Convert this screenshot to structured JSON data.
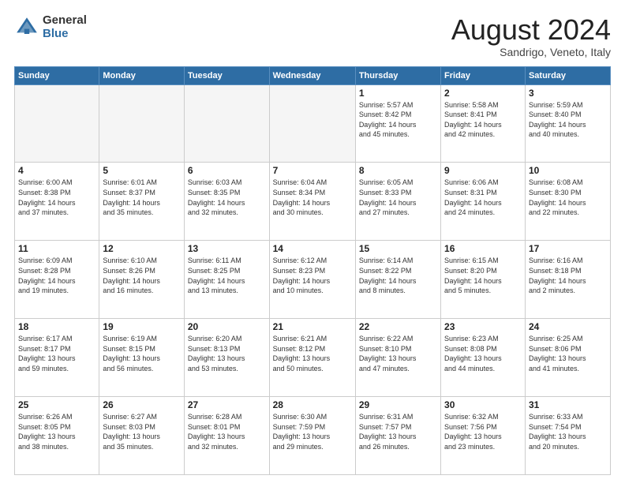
{
  "header": {
    "logo_general": "General",
    "logo_blue": "Blue",
    "month_title": "August 2024",
    "location": "Sandrigo, Veneto, Italy"
  },
  "weekdays": [
    "Sunday",
    "Monday",
    "Tuesday",
    "Wednesday",
    "Thursday",
    "Friday",
    "Saturday"
  ],
  "weeks": [
    [
      {
        "day": "",
        "info": ""
      },
      {
        "day": "",
        "info": ""
      },
      {
        "day": "",
        "info": ""
      },
      {
        "day": "",
        "info": ""
      },
      {
        "day": "1",
        "info": "Sunrise: 5:57 AM\nSunset: 8:42 PM\nDaylight: 14 hours\nand 45 minutes."
      },
      {
        "day": "2",
        "info": "Sunrise: 5:58 AM\nSunset: 8:41 PM\nDaylight: 14 hours\nand 42 minutes."
      },
      {
        "day": "3",
        "info": "Sunrise: 5:59 AM\nSunset: 8:40 PM\nDaylight: 14 hours\nand 40 minutes."
      }
    ],
    [
      {
        "day": "4",
        "info": "Sunrise: 6:00 AM\nSunset: 8:38 PM\nDaylight: 14 hours\nand 37 minutes."
      },
      {
        "day": "5",
        "info": "Sunrise: 6:01 AM\nSunset: 8:37 PM\nDaylight: 14 hours\nand 35 minutes."
      },
      {
        "day": "6",
        "info": "Sunrise: 6:03 AM\nSunset: 8:35 PM\nDaylight: 14 hours\nand 32 minutes."
      },
      {
        "day": "7",
        "info": "Sunrise: 6:04 AM\nSunset: 8:34 PM\nDaylight: 14 hours\nand 30 minutes."
      },
      {
        "day": "8",
        "info": "Sunrise: 6:05 AM\nSunset: 8:33 PM\nDaylight: 14 hours\nand 27 minutes."
      },
      {
        "day": "9",
        "info": "Sunrise: 6:06 AM\nSunset: 8:31 PM\nDaylight: 14 hours\nand 24 minutes."
      },
      {
        "day": "10",
        "info": "Sunrise: 6:08 AM\nSunset: 8:30 PM\nDaylight: 14 hours\nand 22 minutes."
      }
    ],
    [
      {
        "day": "11",
        "info": "Sunrise: 6:09 AM\nSunset: 8:28 PM\nDaylight: 14 hours\nand 19 minutes."
      },
      {
        "day": "12",
        "info": "Sunrise: 6:10 AM\nSunset: 8:26 PM\nDaylight: 14 hours\nand 16 minutes."
      },
      {
        "day": "13",
        "info": "Sunrise: 6:11 AM\nSunset: 8:25 PM\nDaylight: 14 hours\nand 13 minutes."
      },
      {
        "day": "14",
        "info": "Sunrise: 6:12 AM\nSunset: 8:23 PM\nDaylight: 14 hours\nand 10 minutes."
      },
      {
        "day": "15",
        "info": "Sunrise: 6:14 AM\nSunset: 8:22 PM\nDaylight: 14 hours\nand 8 minutes."
      },
      {
        "day": "16",
        "info": "Sunrise: 6:15 AM\nSunset: 8:20 PM\nDaylight: 14 hours\nand 5 minutes."
      },
      {
        "day": "17",
        "info": "Sunrise: 6:16 AM\nSunset: 8:18 PM\nDaylight: 14 hours\nand 2 minutes."
      }
    ],
    [
      {
        "day": "18",
        "info": "Sunrise: 6:17 AM\nSunset: 8:17 PM\nDaylight: 13 hours\nand 59 minutes."
      },
      {
        "day": "19",
        "info": "Sunrise: 6:19 AM\nSunset: 8:15 PM\nDaylight: 13 hours\nand 56 minutes."
      },
      {
        "day": "20",
        "info": "Sunrise: 6:20 AM\nSunset: 8:13 PM\nDaylight: 13 hours\nand 53 minutes."
      },
      {
        "day": "21",
        "info": "Sunrise: 6:21 AM\nSunset: 8:12 PM\nDaylight: 13 hours\nand 50 minutes."
      },
      {
        "day": "22",
        "info": "Sunrise: 6:22 AM\nSunset: 8:10 PM\nDaylight: 13 hours\nand 47 minutes."
      },
      {
        "day": "23",
        "info": "Sunrise: 6:23 AM\nSunset: 8:08 PM\nDaylight: 13 hours\nand 44 minutes."
      },
      {
        "day": "24",
        "info": "Sunrise: 6:25 AM\nSunset: 8:06 PM\nDaylight: 13 hours\nand 41 minutes."
      }
    ],
    [
      {
        "day": "25",
        "info": "Sunrise: 6:26 AM\nSunset: 8:05 PM\nDaylight: 13 hours\nand 38 minutes."
      },
      {
        "day": "26",
        "info": "Sunrise: 6:27 AM\nSunset: 8:03 PM\nDaylight: 13 hours\nand 35 minutes."
      },
      {
        "day": "27",
        "info": "Sunrise: 6:28 AM\nSunset: 8:01 PM\nDaylight: 13 hours\nand 32 minutes."
      },
      {
        "day": "28",
        "info": "Sunrise: 6:30 AM\nSunset: 7:59 PM\nDaylight: 13 hours\nand 29 minutes."
      },
      {
        "day": "29",
        "info": "Sunrise: 6:31 AM\nSunset: 7:57 PM\nDaylight: 13 hours\nand 26 minutes."
      },
      {
        "day": "30",
        "info": "Sunrise: 6:32 AM\nSunset: 7:56 PM\nDaylight: 13 hours\nand 23 minutes."
      },
      {
        "day": "31",
        "info": "Sunrise: 6:33 AM\nSunset: 7:54 PM\nDaylight: 13 hours\nand 20 minutes."
      }
    ]
  ]
}
